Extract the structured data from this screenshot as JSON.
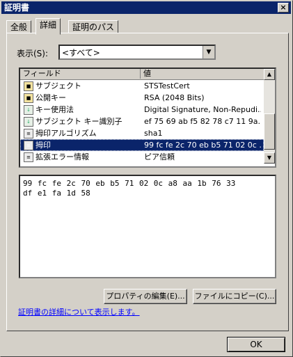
{
  "window": {
    "title": "証明書",
    "close": "×"
  },
  "tabs": [
    "全般",
    "詳細",
    "証明のパス"
  ],
  "show": {
    "label": "表示(S):",
    "value": "<すべて>"
  },
  "list": {
    "columns": [
      "フィールド",
      "値"
    ],
    "rows": [
      {
        "icon": "cert-icon",
        "field": "サブジェクト",
        "value": "STSTestCert"
      },
      {
        "icon": "cert-icon",
        "field": "公開キー",
        "value": "RSA (2048 Bits)"
      },
      {
        "icon": "download-icon",
        "field": "キー使用法",
        "value": "Digital Signature, Non-Repudi..."
      },
      {
        "icon": "download-icon",
        "field": "サブジェクト キー識別子",
        "value": "ef 75 69 ab f5 82 78 c7 11 9a..."
      },
      {
        "icon": "doc-icon",
        "field": "拇印アルゴリズム",
        "value": "sha1"
      },
      {
        "icon": "doc-icon",
        "field": "拇印",
        "value": "99 fc fe 2c 70 eb b5 71 02 0c ...",
        "selected": true
      },
      {
        "icon": "doc-icon",
        "field": "拡張エラー情報",
        "value": "ピア信頼"
      }
    ]
  },
  "value_text": "99 fc fe 2c 70 eb b5 71 02 0c a8 aa 1b 76 33\ndf e1 fa 1d 58",
  "buttons": {
    "edit": "プロパティの編集(E)...",
    "copy": "ファイルにコピー(C)..."
  },
  "link": "証明書の詳細について表示します。",
  "ok": "OK"
}
